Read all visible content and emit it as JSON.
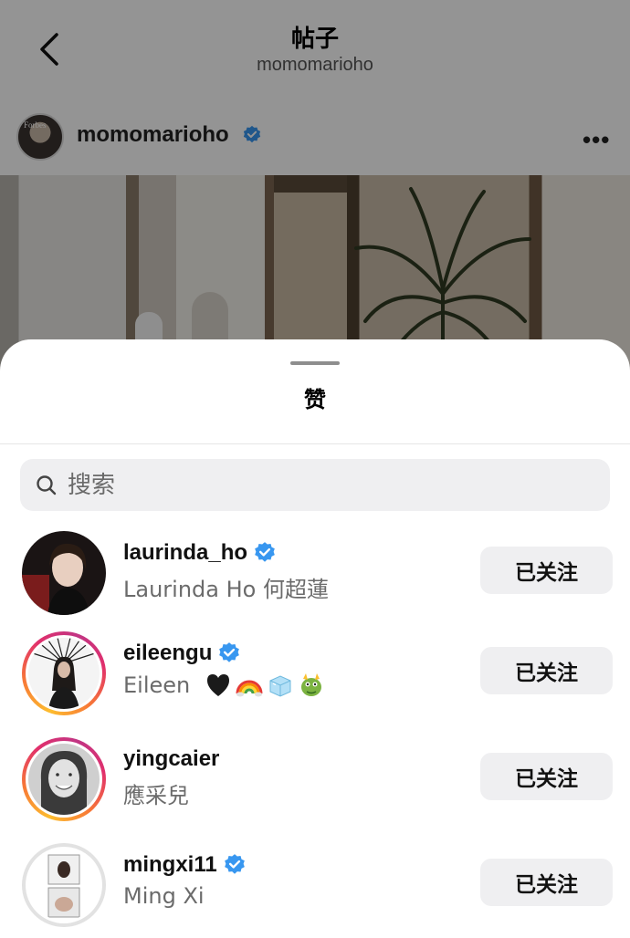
{
  "nav": {
    "title": "帖子",
    "subtitle": "momomarioho"
  },
  "post": {
    "username": "momomarioho",
    "more_icon": "more-horizontal-icon",
    "more_label": "•••"
  },
  "sheet": {
    "title": "赞",
    "search_placeholder": "搜索"
  },
  "likes": [
    {
      "username": "laurinda_ho",
      "full_name": "Laurinda Ho 何超蓮",
      "verified": true,
      "story_ring": false,
      "button": "已关注"
    },
    {
      "username": "eileengu",
      "full_name": "Eileen",
      "emojis": [
        "black-heart",
        "rainbow",
        "ice-cube",
        "dragon-face"
      ],
      "verified": true,
      "story_ring": true,
      "button": "已关注"
    },
    {
      "username": "yingcaier",
      "full_name": "應采兒",
      "verified": false,
      "story_ring": true,
      "button": "已关注"
    },
    {
      "username": "mingxi11",
      "full_name": "Ming Xi",
      "verified": true,
      "story_ring": false,
      "button": "已关注"
    }
  ],
  "colors": {
    "verified_blue": "#3897f0",
    "button_bg": "#efeff1",
    "secondary_text": "#6b6b6b"
  }
}
